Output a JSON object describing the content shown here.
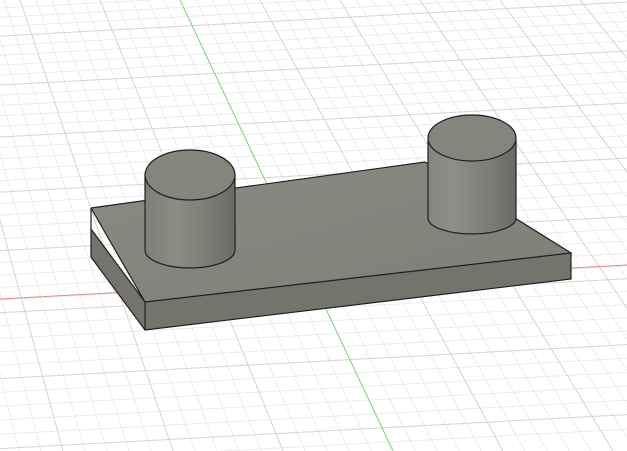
{
  "viewport": {
    "background": "#ffffff",
    "grid_minor_color": "#e9e9e9",
    "grid_major_color": "#d4d4d4",
    "x_axis_color": "#e58585",
    "y_axis_color": "#82d482"
  },
  "model": {
    "name": "",
    "body_color": "#8e8e86",
    "top_color": "#85857e",
    "side_color": "#74746d",
    "edge_color": "#1e1e1e",
    "features": [
      "base-plate",
      "cylinder-boss-left",
      "cylinder-boss-right"
    ]
  }
}
